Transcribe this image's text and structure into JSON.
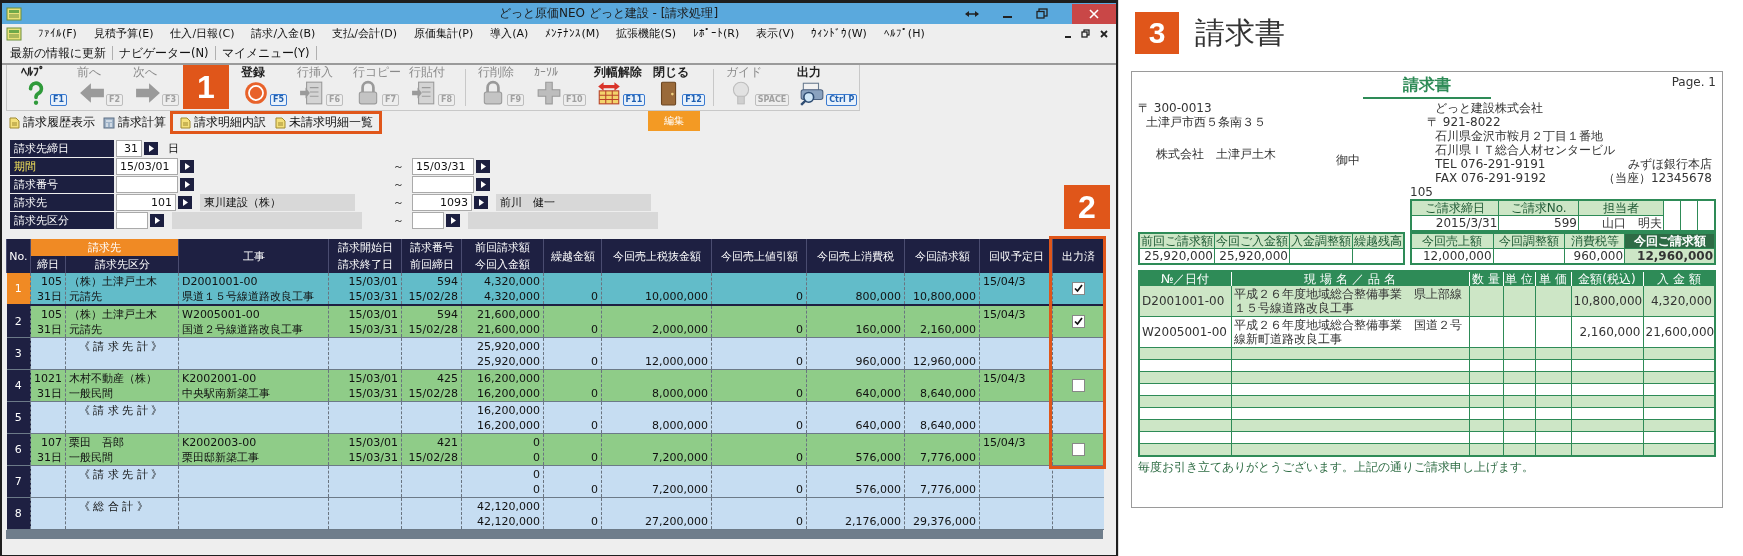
{
  "window": {
    "title": "どっと原価NEO どっと建設 - [請求処理]"
  },
  "menu": [
    "ﾌｧｲﾙ(F)",
    "見積予算(E)",
    "仕入/日報(C)",
    "請求/入金(B)",
    "支払/会計(D)",
    "原価集計(P)",
    "導入(A)",
    "ﾒﾝﾃﾅﾝｽ(M)",
    "拡張機能(S)",
    "ﾚﾎﾟｰﾄ(R)",
    "表示(V)",
    "ｳｨﾝﾄﾞｳ(W)",
    "ﾍﾙﾌﾟ(H)"
  ],
  "quickbar": [
    "最新の情報に更新",
    "ナビゲーター(N)",
    "マイメニュー(Y)"
  ],
  "toolbar": {
    "items": [
      {
        "kind": "help",
        "label": "ﾍﾙﾌﾟ",
        "key": "F1",
        "disabled": false,
        "separator_before": false
      },
      {
        "kind": "back",
        "label": "前へ",
        "key": "F2",
        "disabled": true,
        "separator_before": false
      },
      {
        "kind": "forward",
        "label": "次へ",
        "key": "F3",
        "disabled": true,
        "separator_before": false
      },
      {
        "kind": "callout",
        "label": "1"
      },
      {
        "kind": "ok",
        "label": "登録",
        "key": "F5",
        "disabled": false,
        "separator_before": false
      },
      {
        "kind": "insert",
        "label": "行挿入",
        "key": "F6",
        "disabled": true,
        "separator_before": false
      },
      {
        "kind": "copy",
        "label": "行コピー",
        "key": "F7",
        "disabled": true,
        "separator_before": false
      },
      {
        "kind": "paste",
        "label": "行貼付",
        "key": "F8",
        "disabled": true,
        "separator_before": false
      },
      {
        "kind": "delete",
        "label": "行削除",
        "key": "F9",
        "disabled": true,
        "separator_before": true
      },
      {
        "kind": "cursor",
        "label": "ｶｰｿﾙ",
        "key": "F10",
        "disabled": true,
        "separator_before": false
      },
      {
        "kind": "columns",
        "label": "列幅解除",
        "key": "F11",
        "disabled": false,
        "separator_before": false
      },
      {
        "kind": "close",
        "label": "閉じる",
        "key": "F12",
        "disabled": false,
        "separator_before": false
      },
      {
        "kind": "guide",
        "label": "ガイド",
        "key": "SPACE",
        "disabled": true,
        "separator_before": true
      },
      {
        "kind": "print",
        "label": "出力",
        "key": "Ctrl P",
        "disabled": false,
        "separator_before": false
      }
    ],
    "group_label": "編集"
  },
  "actions": [
    {
      "kind": "page",
      "label": "請求履歴表示",
      "highlighted": false
    },
    {
      "kind": "calculator",
      "label": "請求計算",
      "highlighted": false
    },
    {
      "kind": "page",
      "label": "請求明細内訳",
      "highlighted": true
    },
    {
      "kind": "page",
      "label": "未請求明細一覧",
      "highlighted": true
    }
  ],
  "form": {
    "callout": "2",
    "rows": [
      {
        "kind": "day",
        "label": "請求先締日",
        "highlighted": false,
        "from": {
          "value": "31"
        },
        "unit": "日"
      },
      {
        "kind": "range",
        "label": "期間",
        "highlighted": true,
        "from": {
          "value": "15/03/01"
        },
        "range_mark": "～",
        "to": {
          "value": "15/03/31"
        }
      },
      {
        "kind": "range",
        "label": "請求番号",
        "highlighted": false,
        "from": {},
        "range_mark": "～",
        "to": {}
      },
      {
        "kind": "party_range",
        "label": "請求先",
        "highlighted": false,
        "from": {
          "value": "101",
          "name": "東川建設（株）"
        },
        "range_mark": "～",
        "to": {
          "value": "1093",
          "name": "前川　健一"
        }
      },
      {
        "kind": "class_range",
        "label": "請求先区分",
        "highlighted": false,
        "from": {},
        "range_mark": "～",
        "to": {}
      }
    ]
  },
  "table": {
    "group": {
      "label": "請求先",
      "highlighted": true
    },
    "columns": [
      {
        "kind": "single",
        "label": "No."
      },
      {
        "kind": "grouped",
        "label": "締日"
      },
      {
        "kind": "grouped",
        "label": "請求先区分"
      },
      {
        "kind": "single",
        "label": "工事"
      },
      {
        "kind": "stacked",
        "top": "請求開始日",
        "bottom": "請求終了日"
      },
      {
        "kind": "stacked",
        "top": "請求番号",
        "bottom": "前回締日"
      },
      {
        "kind": "stacked",
        "top": "前回請求額",
        "bottom": "今回入金額"
      },
      {
        "kind": "single",
        "label": "繰越金額"
      },
      {
        "kind": "single",
        "label": "今回売上税抜金額"
      },
      {
        "kind": "single",
        "label": "今回売上値引額"
      },
      {
        "kind": "single",
        "label": "今回売上消費税"
      },
      {
        "kind": "single",
        "label": "今回請求額"
      },
      {
        "kind": "single",
        "label": "回収予定日"
      },
      {
        "kind": "single",
        "label": "出力済",
        "highlighted": true
      }
    ],
    "rows": [
      {
        "kind": "detail",
        "selected": true,
        "no": "1",
        "code": "105",
        "day": "31日",
        "name": "（株）土津戸土木",
        "category": "元請先",
        "job_code": "D2001001-00",
        "job_name": "県道１５号線道路改良工事",
        "start": "15/03/01",
        "end": "15/03/31",
        "bill_no": "594",
        "prev_close": "15/02/28",
        "prev_amount": "4,320,000",
        "received": "4,320,000",
        "carry": "0",
        "sales": "10,000,000",
        "discount": "0",
        "tax": "800,000",
        "billed": "10,800,000",
        "due": "15/04/3",
        "printed": true
      },
      {
        "kind": "detail",
        "selected": false,
        "no": "2",
        "code": "105",
        "day": "31日",
        "name": "（株）土津戸土木",
        "category": "元請先",
        "job_code": "W2005001-00",
        "job_name": "国道２号線道路改良工事",
        "start": "15/03/01",
        "end": "15/03/31",
        "bill_no": "594",
        "prev_close": "15/02/28",
        "prev_amount": "21,600,000",
        "received": "21,600,000",
        "carry": "0",
        "sales": "2,000,000",
        "discount": "0",
        "tax": "160,000",
        "billed": "2,160,000",
        "due": "15/04/3",
        "printed": true
      },
      {
        "kind": "subtotal",
        "selected": false,
        "no": "3",
        "name": "《 請 求 先 計 》",
        "prev_amount": "25,920,000",
        "received": "25,920,000",
        "carry": "0",
        "sales": "12,000,000",
        "discount": "0",
        "tax": "960,000",
        "billed": "12,960,000"
      },
      {
        "kind": "detail",
        "selected": false,
        "no": "4",
        "code": "1021",
        "day": "31日",
        "name": "木村不動産（株）",
        "category": "一般民間",
        "job_code": "K2002001-00",
        "job_name": "中央駅南新築工事",
        "start": "15/03/01",
        "end": "15/03/31",
        "bill_no": "425",
        "prev_close": "15/02/28",
        "prev_amount": "16,200,000",
        "received": "16,200,000",
        "carry": "0",
        "sales": "8,000,000",
        "discount": "0",
        "tax": "640,000",
        "billed": "8,640,000",
        "due": "15/04/3",
        "printed": false
      },
      {
        "kind": "subtotal",
        "selected": false,
        "no": "5",
        "name": "《 請 求 先 計 》",
        "prev_amount": "16,200,000",
        "received": "16,200,000",
        "carry": "0",
        "sales": "8,000,000",
        "discount": "0",
        "tax": "640,000",
        "billed": "8,640,000"
      },
      {
        "kind": "detail",
        "selected": false,
        "no": "6",
        "code": "107",
        "day": "31日",
        "name": "栗田　吾郎",
        "category": "一般民間",
        "job_code": "K2002003-00",
        "job_name": "栗田邸新築工事",
        "start": "15/03/01",
        "end": "15/03/31",
        "bill_no": "421",
        "prev_close": "15/02/28",
        "prev_amount": "0",
        "received": "0",
        "carry": "0",
        "sales": "7,200,000",
        "discount": "0",
        "tax": "576,000",
        "billed": "7,776,000",
        "due": "15/04/3",
        "printed": false
      },
      {
        "kind": "subtotal",
        "selected": false,
        "no": "7",
        "name": "《 請 求 先 計 》",
        "prev_amount": "0",
        "received": "0",
        "carry": "0",
        "sales": "7,200,000",
        "discount": "0",
        "tax": "576,000",
        "billed": "7,776,000"
      },
      {
        "kind": "total",
        "selected": false,
        "no": "8",
        "name": "《 総 合 計 》",
        "prev_amount": "42,120,000",
        "received": "42,120,000",
        "carry": "0",
        "sales": "27,200,000",
        "discount": "0",
        "tax": "2,176,000",
        "billed": "29,376,000"
      }
    ]
  },
  "invoice": {
    "callout": "3",
    "heading": "請求書",
    "document": {
      "title": "請求書",
      "page": "Page. 1",
      "recipient": {
        "postcode": "〒 300-0013",
        "address": "土津戸市西５条南３５",
        "company": "株式会社　土津戸土木",
        "honorific": "御中",
        "code": "105"
      },
      "sender": {
        "company": "どっと建設株式会社",
        "postcode": "〒 921-8022",
        "address1": "石川県金沢市鞍月２丁目１番地",
        "address2": "石川県ＩＴ総合人材センタービル",
        "tel": "TEL 076-291-9191",
        "fax": "FAX 076-291-9192",
        "bank": "みずほ銀行本店",
        "account": "（当座）12345678"
      },
      "info": [
        {
          "label": "ご請求締日",
          "value": "2015/3/31"
        },
        {
          "label": "ご請求No.",
          "value": "599"
        },
        {
          "label": "担当者",
          "value": "山口　明夫"
        }
      ],
      "balance": [
        {
          "label": "前回ご請求額",
          "value": "25,920,000"
        },
        {
          "label": "今回ご入金額",
          "value": "25,920,000"
        },
        {
          "label": "入金調整額"
        },
        {
          "label": "繰越残高"
        }
      ],
      "totals": [
        {
          "label": "今回売上額",
          "value": "12,000,000",
          "emphasis": false
        },
        {
          "label": "今回調整額",
          "emphasis": false
        },
        {
          "label": "消費税等",
          "value": "960,000",
          "emphasis": false
        },
        {
          "label": "今回ご請求額",
          "value": "12,960,000",
          "emphasis": true
        }
      ],
      "columns": [
        "№／日付",
        "現 場 名 ／ 品 名",
        "数 量",
        "単 位",
        "単 価",
        "金額(税込)",
        "入 金 額"
      ],
      "lines": [
        {
          "code": "D2001001-00",
          "description": "平成２６年度地域総合整備事業　県上部線１５号線道路改良工事",
          "amount": "10,800,000",
          "paid": "4,320,000"
        },
        {
          "code": "W2005001-00",
          "description": "平成２６年度地域総合整備事業　国道２号線新町道路改良工事",
          "amount": "2,160,000",
          "paid": "21,600,000"
        }
      ],
      "footer": "毎度お引き立てありがとうございます。上記の通りご請求申し上げます。"
    }
  }
}
